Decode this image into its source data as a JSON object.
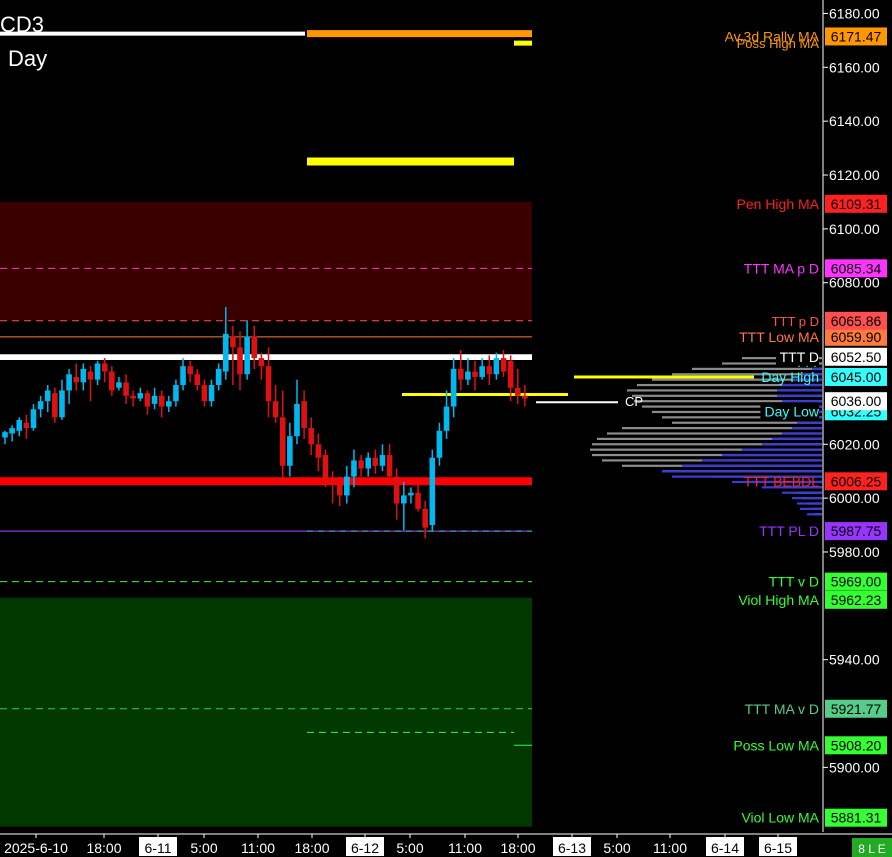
{
  "header": {
    "symbol": "CD3",
    "period": "Day"
  },
  "colors": {
    "background": "#000000",
    "bull": "#00b8f0",
    "bear": "#dd1111",
    "penZone": "#3a0000",
    "violZone": "#003800",
    "profileGray": "#8c8c8c",
    "profileBlue": "#3b3bd8"
  },
  "bottom_bar": {
    "indicator": "8 L E"
  },
  "chart_data": {
    "type": "candlestick",
    "ylim": [
      5876,
      6185
    ],
    "y_ticks": [
      6180,
      6160,
      6140,
      6120,
      6100,
      6080,
      6020,
      6000,
      5980,
      5940,
      5900
    ],
    "y_tick_labels": [
      "6180.00",
      "6160.00",
      "6140.00",
      "6120.00",
      "6100.00",
      "6080.00",
      "6020.00",
      "6000.00",
      "5980.00",
      "5940.00",
      "5900.00"
    ],
    "x_labels": [
      {
        "text": "2025-6-10",
        "boxed": false
      },
      {
        "text": "18:00",
        "boxed": false
      },
      {
        "text": "6-11",
        "boxed": true
      },
      {
        "text": "5:00",
        "boxed": false
      },
      {
        "text": "11:00",
        "boxed": false
      },
      {
        "text": "18:00",
        "boxed": false
      },
      {
        "text": "6-12",
        "boxed": true
      },
      {
        "text": "5:00",
        "boxed": false
      },
      {
        "text": "11:00",
        "boxed": false
      },
      {
        "text": "18:00",
        "boxed": false
      },
      {
        "text": "6-13",
        "boxed": true
      },
      {
        "text": "5:00",
        "boxed": false
      },
      {
        "text": "11:00",
        "boxed": false
      },
      {
        "text": "6-14",
        "boxed": true
      },
      {
        "text": "6-15",
        "boxed": true
      }
    ],
    "candles": [
      [
        6022.5,
        6024.5,
        6020,
        6025
      ],
      [
        6024,
        6026,
        6021,
        6027
      ],
      [
        6025,
        6029,
        6023,
        6030
      ],
      [
        6028,
        6026,
        6022,
        6031
      ],
      [
        6026,
        6033,
        6025,
        6035
      ],
      [
        6033,
        6036,
        6030,
        6038
      ],
      [
        6036,
        6040,
        6032,
        6042
      ],
      [
        6039,
        6030,
        6028,
        6041
      ],
      [
        6030,
        6040,
        6029,
        6044
      ],
      [
        6040,
        6046,
        6035,
        6048
      ],
      [
        6045,
        6043,
        6040,
        6050
      ],
      [
        6043,
        6048,
        6040,
        6050
      ],
      [
        6047,
        6044,
        6036,
        6049
      ],
      [
        6044,
        6050,
        6042,
        6051
      ],
      [
        6050,
        6047,
        6043,
        6052
      ],
      [
        6047,
        6040,
        6038,
        6049
      ],
      [
        6041,
        6043,
        6040,
        6045
      ],
      [
        6043,
        6038,
        6035,
        6046
      ],
      [
        6038,
        6037,
        6034,
        6040
      ],
      [
        6037,
        6039,
        6036,
        6041
      ],
      [
        6039,
        6034,
        6031,
        6040
      ],
      [
        6035,
        6038,
        6033,
        6041
      ],
      [
        6038,
        6034,
        6030,
        6040
      ],
      [
        6034,
        6036,
        6032,
        6038
      ],
      [
        6036,
        6042,
        6034,
        6044
      ],
      [
        6042,
        6049,
        6040,
        6052
      ],
      [
        6049,
        6046,
        6043,
        6051
      ],
      [
        6046,
        6042,
        6040,
        6048
      ],
      [
        6042,
        6036,
        6034,
        6044
      ],
      [
        6036,
        6042,
        6034,
        6044
      ],
      [
        6042,
        6048,
        6040,
        6050
      ],
      [
        6047,
        6061,
        6044,
        6071
      ],
      [
        6060,
        6056,
        6042,
        6064
      ],
      [
        6056,
        6046,
        6040,
        6062
      ],
      [
        6046,
        6060,
        6044,
        6066
      ],
      [
        6060,
        6052,
        6048,
        6064
      ],
      [
        6052,
        6049,
        6044,
        6054
      ],
      [
        6049,
        6036,
        6030,
        6056
      ],
      [
        6036,
        6030,
        6028,
        6042
      ],
      [
        6030,
        6012,
        6005,
        6040
      ],
      [
        6012,
        6023,
        6008,
        6028
      ],
      [
        6023,
        6035,
        6020,
        6044
      ],
      [
        6036,
        6026,
        6022,
        6040
      ],
      [
        6026,
        6020,
        6016,
        6030
      ],
      [
        6020,
        6015,
        6010,
        6024
      ],
      [
        6016,
        6006,
        6004,
        6018
      ],
      [
        6006,
        6005,
        5998,
        6010
      ],
      [
        6005,
        6001,
        5997,
        6008
      ],
      [
        6001,
        6008,
        5998,
        6012
      ],
      [
        6008,
        6014,
        6004,
        6018
      ],
      [
        6014,
        6011,
        6008,
        6016
      ],
      [
        6011,
        6015,
        6008,
        6017
      ],
      [
        6015,
        6012,
        6009,
        6018
      ],
      [
        6012,
        6016,
        6010,
        6020
      ],
      [
        6016,
        6008,
        6006,
        6020
      ],
      [
        6008,
        5998,
        5992,
        6011
      ],
      [
        5998,
        6001,
        5988,
        6006
      ],
      [
        6001,
        6002,
        5998,
        6004
      ],
      [
        6002,
        5996,
        5995,
        6007
      ],
      [
        5996,
        5989,
        5985,
        5999
      ],
      [
        5990,
        6015,
        5988,
        6018
      ],
      [
        6015,
        6025,
        6012,
        6028
      ],
      [
        6025,
        6034,
        6022,
        6040
      ],
      [
        6034,
        6048,
        6030,
        6052
      ],
      [
        6048,
        6044,
        6040,
        6055
      ],
      [
        6044,
        6047,
        6042,
        6052
      ],
      [
        6047,
        6045,
        6040,
        6051
      ],
      [
        6045,
        6049,
        6044,
        6052
      ],
      [
        6049,
        6046,
        6042,
        6053
      ],
      [
        6046,
        6052,
        6044,
        6054
      ],
      [
        6052,
        6047,
        6045,
        6055
      ],
      [
        6051,
        6041,
        6036,
        6053
      ],
      [
        6041,
        6038,
        6035,
        6048
      ],
      [
        6038,
        6037,
        6034,
        6042
      ]
    ],
    "levels": [
      {
        "name": "Av.3d Rally MA",
        "value": 6171.47,
        "label_color": "#ff9800",
        "tag_bg": "#ff9800",
        "tag_fg": "#000000"
      },
      {
        "name": "Pen High MA",
        "value": 6109.31,
        "label_color": "#ff2020",
        "tag_bg": "#ff2020",
        "tag_fg": "#000000"
      },
      {
        "name": "TTT MA p D",
        "value": 6085.34,
        "label_color": "#ff33ff",
        "tag_bg": "#ff33ff",
        "tag_fg": "#000000"
      },
      {
        "name": "TTT Low MA",
        "value": 6059.9,
        "label_color": "#ff7a3d",
        "tag_bg": "#ff7a3d",
        "tag_fg": "#000000"
      },
      {
        "name": "TTT D",
        "value": 6052.5,
        "label_color": "#ffffff",
        "tag_bg": "#ffffff",
        "tag_fg": "#000000"
      },
      {
        "name": "Day High",
        "value": 6045.0,
        "label_color": "#33ffff",
        "tag_bg": "#33ffff",
        "tag_fg": "#000000"
      },
      {
        "name": "Day Low",
        "value": 6032.25,
        "label_color": "#33ffff",
        "tag_bg": "#33ffff",
        "tag_fg": "#000000"
      },
      {
        "name": "TTT BEBDL",
        "value": 6006.25,
        "label_color": "#ff2020",
        "tag_bg": "#ff2020",
        "tag_fg": "#000000"
      },
      {
        "name": "TTT PL D",
        "value": 5987.75,
        "label_color": "#9933ff",
        "tag_bg": "#9933ff",
        "tag_fg": "#000000"
      },
      {
        "name": "TTT v D",
        "value": 5969.0,
        "label_color": "#33ff33",
        "tag_bg": "#33ff33",
        "tag_fg": "#000000"
      },
      {
        "name": "Viol High MA",
        "value": 5962.23,
        "label_color": "#33ff33",
        "tag_bg": "#33ff33",
        "tag_fg": "#000000"
      },
      {
        "name": "TTT MA v D",
        "value": 5921.77,
        "label_color": "#55cc88",
        "tag_bg": "#55cc88",
        "tag_fg": "#000000"
      },
      {
        "name": "Poss Low MA",
        "value": 5908.2,
        "label_color": "#33ff33",
        "tag_bg": "#33ff33",
        "tag_fg": "#000000"
      },
      {
        "name": "Viol Low MA",
        "value": 5881.31,
        "label_color": "#33ff33",
        "tag_bg": "#33ff33",
        "tag_fg": "#000000"
      }
    ],
    "extra_tags": [
      {
        "value": 6065.86,
        "text": "6065.86",
        "bg": "#ff5050",
        "fg": "#000000",
        "partial": true
      },
      {
        "value": 6036.0,
        "text": "6036.00",
        "bg": "#ffffff",
        "fg": "#000000",
        "partial": false
      }
    ],
    "obscured_labels": [
      {
        "text": "Poss High MA",
        "value": 6169.0,
        "color": "#ff9800"
      },
      {
        "text": "TTT p D",
        "value": 6065.86,
        "color": "#ff5050"
      },
      {
        "text": "TTT",
        "value": 6050.5,
        "color": "#33ffff"
      }
    ],
    "zones": [
      {
        "name": "pen-zone",
        "from": 6066,
        "to": 6110
      },
      {
        "name": "viol-zone",
        "from": 5878,
        "to": 5963
      }
    ],
    "current_price": {
      "label": "CP",
      "value": 6036.0
    },
    "profile": [
      [
        6052,
        80,
        0
      ],
      [
        6050,
        100,
        0
      ],
      [
        6048,
        130,
        10
      ],
      [
        6046,
        150,
        20
      ],
      [
        6044,
        170,
        30
      ],
      [
        6042,
        185,
        40
      ],
      [
        6040,
        195,
        45
      ],
      [
        6038,
        190,
        45
      ],
      [
        6036,
        188,
        40
      ],
      [
        6034,
        180,
        40
      ],
      [
        6032,
        170,
        35
      ],
      [
        6030,
        160,
        30
      ],
      [
        6028,
        150,
        25
      ],
      [
        6026,
        200,
        30
      ],
      [
        6024,
        215,
        40
      ],
      [
        6022,
        225,
        50
      ],
      [
        6020,
        230,
        60
      ],
      [
        6018,
        232,
        80
      ],
      [
        6016,
        230,
        100
      ],
      [
        6014,
        220,
        120
      ],
      [
        6012,
        200,
        140
      ],
      [
        6010,
        160,
        160
      ],
      [
        6008,
        110,
        150
      ],
      [
        6006,
        70,
        90
      ],
      [
        6004,
        40,
        60
      ],
      [
        6002,
        25,
        40
      ],
      [
        6000,
        20,
        30
      ],
      [
        5998,
        15,
        25
      ],
      [
        5996,
        12,
        22
      ],
      [
        5994,
        8,
        15
      ]
    ]
  }
}
